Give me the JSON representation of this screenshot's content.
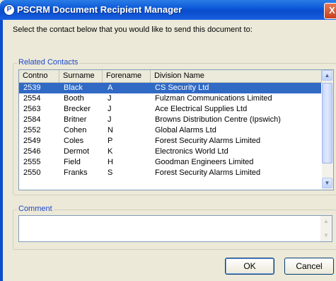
{
  "window": {
    "title": "PSCRM Document Recipient Manager",
    "icon_glyph": "P",
    "close_glyph": "X"
  },
  "instruction": "Select the contact below that you would like to send this document to:",
  "related_contacts": {
    "label": "Related Contacts",
    "columns": [
      "Contno",
      "Surname",
      "Forename",
      "Division Name"
    ],
    "selected_index": 0,
    "rows": [
      {
        "contno": "2539",
        "surname": "Black",
        "forename": "A",
        "division": "CS Security Ltd"
      },
      {
        "contno": "2554",
        "surname": "Booth",
        "forename": "J",
        "division": "Fulzman Communications Limited"
      },
      {
        "contno": "2563",
        "surname": "Brecker",
        "forename": "J",
        "division": "Ace Electrical Supplies Ltd"
      },
      {
        "contno": "2584",
        "surname": "Britner",
        "forename": "J",
        "division": "Browns Distribution Centre (Ipswich)"
      },
      {
        "contno": "2552",
        "surname": "Cohen",
        "forename": "N",
        "division": "Global Alarms Ltd"
      },
      {
        "contno": "2549",
        "surname": "Coles",
        "forename": "P",
        "division": "Forest Security Alarms Limited"
      },
      {
        "contno": "2546",
        "surname": "Dermot",
        "forename": "K",
        "division": "Electronics World Ltd"
      },
      {
        "contno": "2555",
        "surname": "Field",
        "forename": "H",
        "division": "Goodman Engineers Limited"
      },
      {
        "contno": "2550",
        "surname": "Franks",
        "forename": "S",
        "division": "Forest Security Alarms Limited"
      }
    ]
  },
  "comment": {
    "label": "Comment",
    "value": ""
  },
  "buttons": {
    "ok": "OK",
    "cancel": "Cancel"
  },
  "colors": {
    "title_bar": "#0a4ccc",
    "selection": "#316ac5",
    "group_label": "#1f48c8",
    "dialog_background": "#ece9d8"
  },
  "icons": {
    "app": "pscrm-app-icon",
    "close": "close-icon",
    "scroll_up": "chevron-up-icon",
    "scroll_down": "chevron-down-icon"
  }
}
